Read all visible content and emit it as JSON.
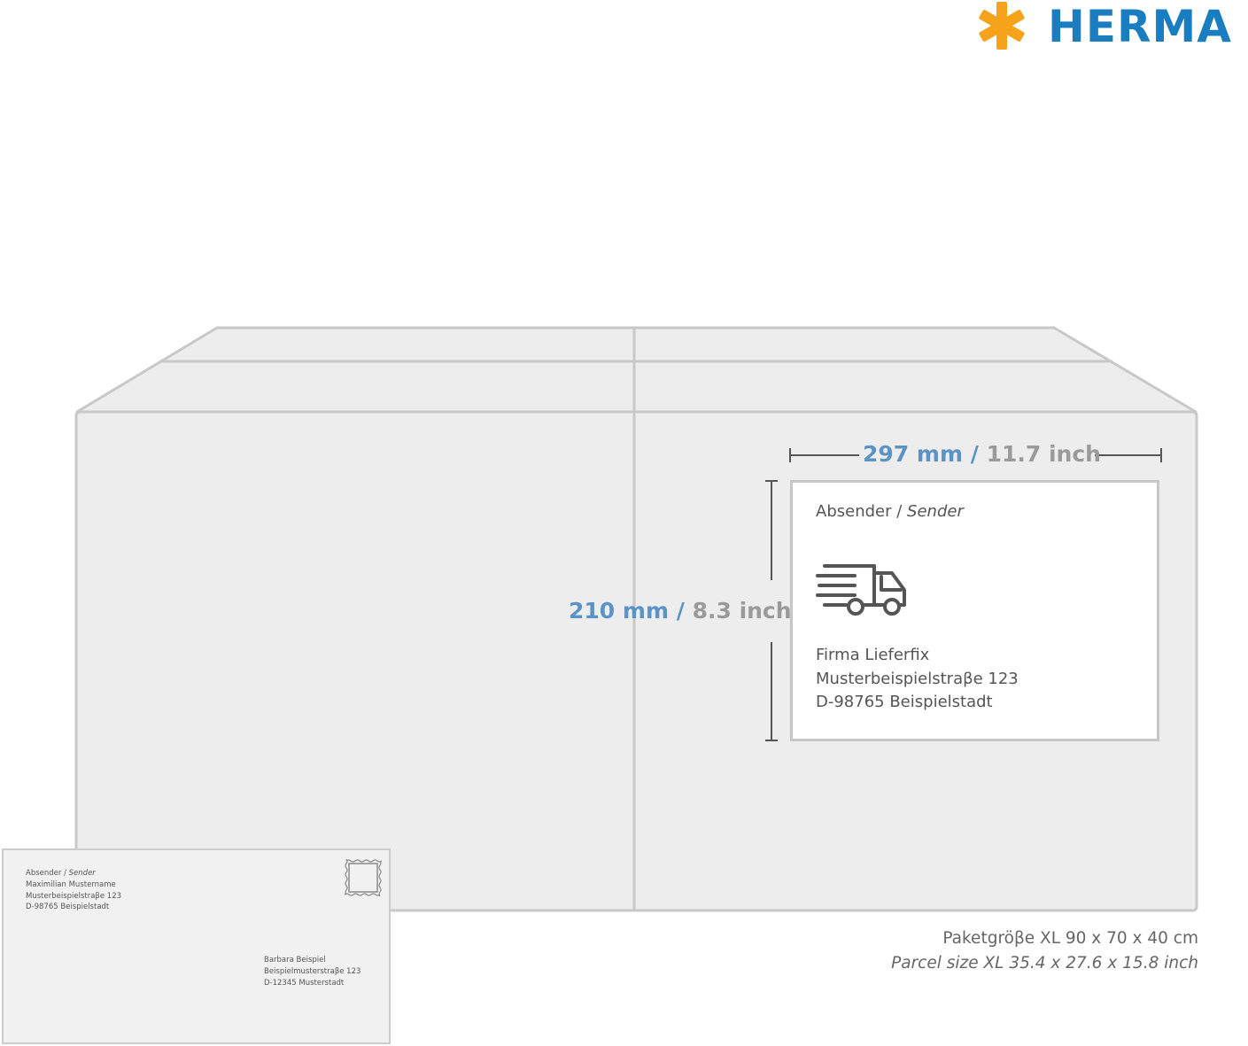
{
  "brand": {
    "name": "HERMA",
    "blue": "#1a7dc0",
    "orange": "#f7a21b"
  },
  "dimensions": {
    "width_mm": "297 mm",
    "width_separator": "/",
    "width_inch": "11.7 inch",
    "height_mm": "210 mm",
    "height_separator": "/",
    "height_inch": "8.3 inch",
    "metric_color": "#5b93c6",
    "imperial_color": "#9a9a9a"
  },
  "label": {
    "sender_label": "Absender",
    "sender_separator": "/",
    "sender_label_en": "Sender",
    "icon": "delivery-truck-icon",
    "address": [
      "Firma Lieferfix",
      "Musterbeispielstraβe 123",
      "D-98765 Beispielstadt"
    ]
  },
  "parcel_size": {
    "de": "Paketgröβe XL 90 x 70 x 40 cm",
    "en": "Parcel size XL 35.4 x 27.6 x 15.8 inch"
  },
  "envelope": {
    "sender_label": "Absender /",
    "sender_label_en": "Sender",
    "sender_lines": [
      "Maximilian Mustername",
      "Musterbeispielstraβe 123",
      "D-98765 Beispielstadt"
    ],
    "recipient_lines": [
      "Barbara Beispiel",
      "Beispielmusterstraβe 123",
      "D-12345 Musterstadt"
    ],
    "stamp_icon": "stamp-icon"
  },
  "colors": {
    "box_fill": "#ededed",
    "box_stroke": "#c8c8c8",
    "text_gray": "#555555"
  }
}
